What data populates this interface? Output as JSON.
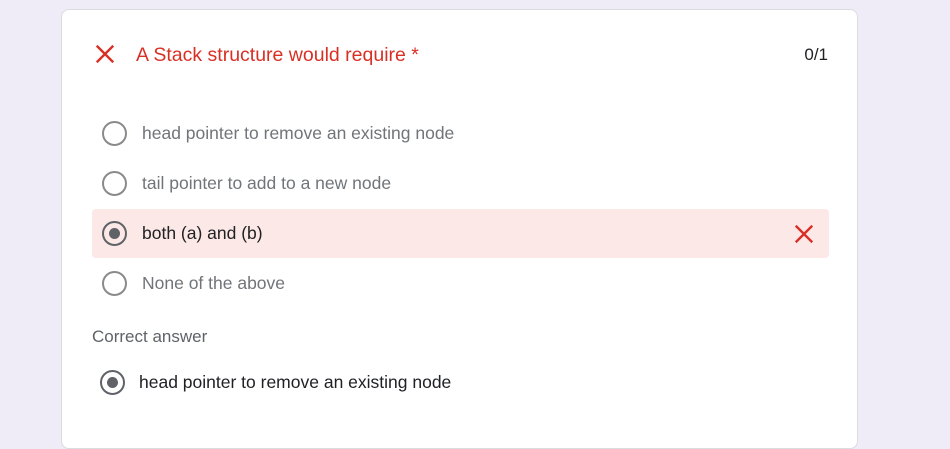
{
  "question": {
    "title": "A Stack structure would require *",
    "score": "0/1",
    "status_icon": "close-icon",
    "status_color": "#d93025"
  },
  "options": [
    {
      "label": "head pointer to remove an existing node",
      "selected": false
    },
    {
      "label": "tail pointer to add to a new node",
      "selected": false
    },
    {
      "label": "both (a) and (b)",
      "selected": true,
      "result": "wrong",
      "result_icon": "close-icon"
    },
    {
      "label": "None of the above",
      "selected": false
    }
  ],
  "correct": {
    "heading": "Correct answer",
    "answer": "head pointer to remove an existing node"
  },
  "colors": {
    "page_background": "#efebf7",
    "card_background": "#ffffff",
    "wrong_highlight": "#fce8e6",
    "error_red": "#d93025"
  }
}
